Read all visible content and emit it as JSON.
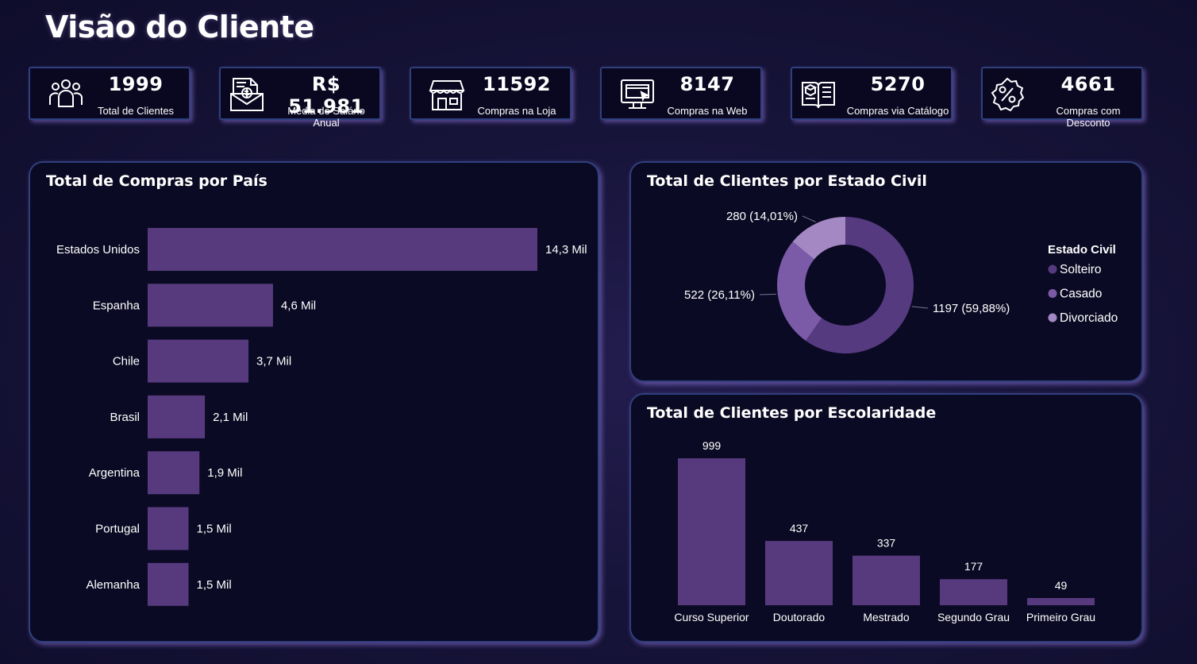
{
  "page": {
    "title": "Visão do Cliente"
  },
  "colors": {
    "bar": "#573a7e",
    "solteiro": "#553a80",
    "casado": "#7b5aa8",
    "divorciado": "#a488c4",
    "panel_border": "#2f3f7e"
  },
  "kpis": [
    {
      "icon": "people-icon",
      "value": "1999",
      "label": "Total de Clientes"
    },
    {
      "icon": "salary-document-icon",
      "value": "R$ 51.981",
      "label": "Média de Salário Anual"
    },
    {
      "icon": "store-icon",
      "value": "11592",
      "label": "Compras na Loja"
    },
    {
      "icon": "web-monitor-icon",
      "value": "8147",
      "label": "Compras na Web"
    },
    {
      "icon": "catalog-book-icon",
      "value": "5270",
      "label": "Compras via Catálogo"
    },
    {
      "icon": "discount-badge-icon",
      "value": "4661",
      "label": "Compras com Desconto"
    }
  ],
  "panels": {
    "country": {
      "title": "Total de Compras por País"
    },
    "marital": {
      "title": "Total de Clientes por Estado Civil",
      "legend_title": "Estado Civil"
    },
    "education": {
      "title": "Total de Clientes por Escolaridade"
    }
  },
  "chart_data": [
    {
      "type": "bar",
      "orientation": "horizontal",
      "title": "Total de Compras por País",
      "categories": [
        "Estados Unidos",
        "Espanha",
        "Chile",
        "Brasil",
        "Argentina",
        "Portugal",
        "Alemanha"
      ],
      "values": [
        14300,
        4600,
        3700,
        2100,
        1900,
        1500,
        1500
      ],
      "data_labels": [
        "14,3 Mil",
        "4,6 Mil",
        "3,7 Mil",
        "2,1 Mil",
        "1,9 Mil",
        "1,5 Mil",
        "1,5 Mil"
      ]
    },
    {
      "type": "pie",
      "donut": true,
      "title": "Total de Clientes por Estado Civil",
      "legend_title": "Estado Civil",
      "legend_position": "right",
      "categories": [
        "Solteiro",
        "Casado",
        "Divorciado"
      ],
      "values": [
        1197,
        522,
        280
      ],
      "data_labels": [
        "1197 (59,88%)",
        "522 (26,11%)",
        "280 (14,01%)"
      ]
    },
    {
      "type": "bar",
      "orientation": "vertical",
      "title": "Total de Clientes por Escolaridade",
      "categories": [
        "Curso Superior",
        "Doutorado",
        "Mestrado",
        "Segundo Grau",
        "Primeiro Grau"
      ],
      "values": [
        999,
        437,
        337,
        177,
        49
      ],
      "data_labels": [
        "999",
        "437",
        "337",
        "177",
        "49"
      ]
    }
  ]
}
